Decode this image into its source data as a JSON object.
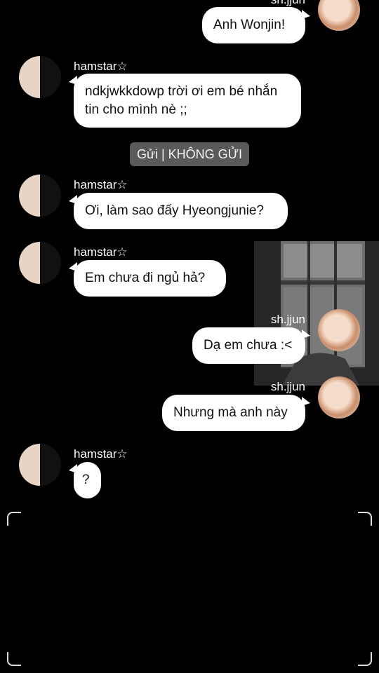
{
  "messages": [
    {
      "sender": "sh.jjun",
      "text": "Anh Wonjin!"
    },
    {
      "sender": "hamstar☆",
      "text": "ndkjwkkdowp trời ơi em bé nhắn tin cho mình nè ;;"
    },
    {
      "system": "Gửi | KHÔNG GỬI"
    },
    {
      "sender": "hamstar☆",
      "text": "Ơi, làm sao đấy Hyeongjunie?"
    },
    {
      "sender": "hamstar☆",
      "text": "Em chưa đi ngủ hả?"
    },
    {
      "sender": "sh.jjun",
      "text": "Dạ em chưa :<"
    },
    {
      "sender": "sh.jjun",
      "text": "Nhưng mà anh này"
    },
    {
      "sender": "hamstar☆",
      "text": "?"
    }
  ],
  "colors": {
    "background": "#000000",
    "bubble": "#ffffff",
    "system_badge": "#5a5a5a"
  }
}
